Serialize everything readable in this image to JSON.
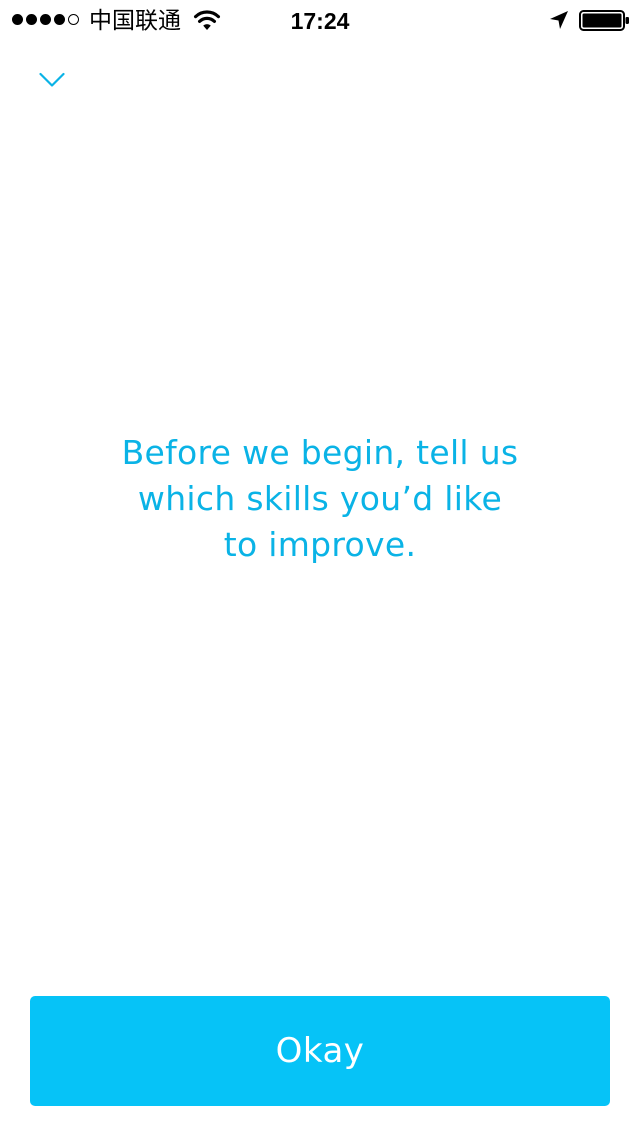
{
  "status_bar": {
    "signal_strength": 4,
    "signal_max": 5,
    "carrier": "中国联通",
    "time": "17:24",
    "icons": [
      "signal-dots",
      "wifi-icon",
      "location-arrow-icon",
      "battery-icon"
    ]
  },
  "header": {
    "dismiss_icon": "chevron-down-icon"
  },
  "main": {
    "prompt": "Before we begin, tell us which skills you’d like to improve."
  },
  "footer": {
    "okay_label": "Okay"
  },
  "colors": {
    "accent_text": "#0ab3e6",
    "button_background": "#06c3f7",
    "button_text": "#ffffff",
    "background": "#ffffff"
  }
}
